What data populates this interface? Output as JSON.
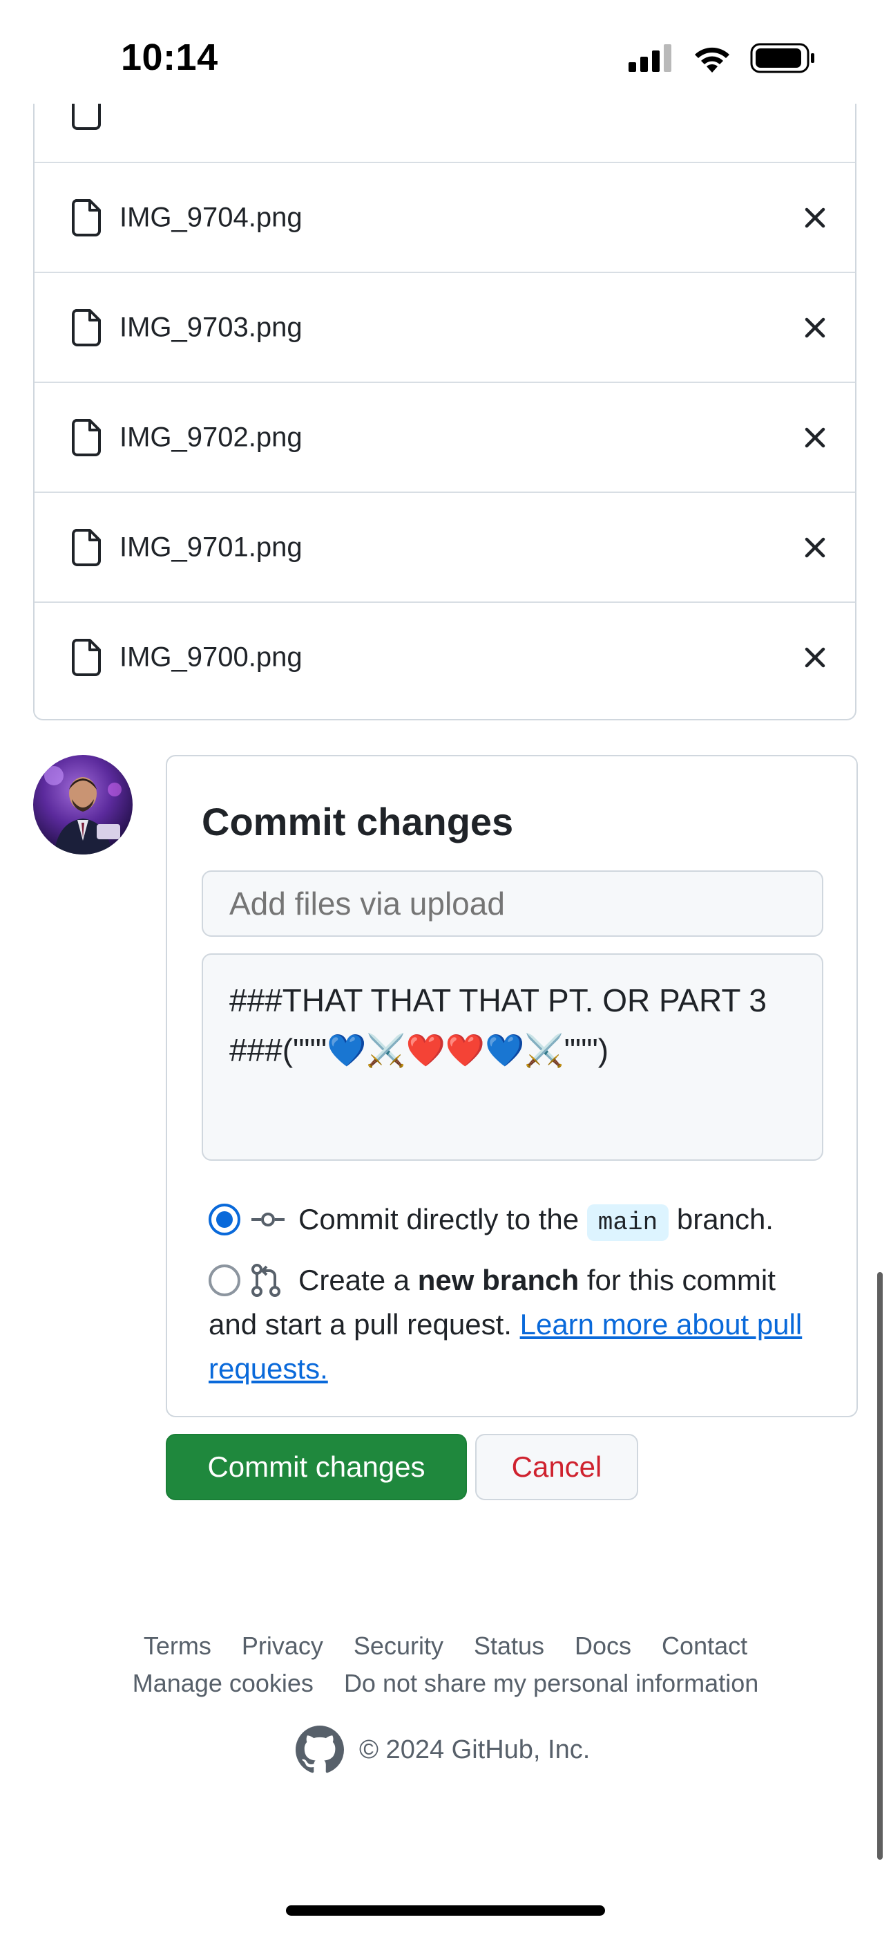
{
  "status_bar": {
    "time": "10:14"
  },
  "files": [
    {
      "name": "IMG_9704.png"
    },
    {
      "name": "IMG_9703.png"
    },
    {
      "name": "IMG_9702.png"
    },
    {
      "name": "IMG_9701.png"
    },
    {
      "name": "IMG_9700.png"
    }
  ],
  "commit": {
    "title": "Commit changes",
    "summary_placeholder": "Add files via upload",
    "description": "###THAT THAT THAT PT. OR PART 3\n###(\"\"\"💙⚔️❤️❤️💙⚔️\"\"\")",
    "option_direct": {
      "before": "Commit directly to the ",
      "branch": "main",
      "after": " branch."
    },
    "option_new_branch": {
      "before": "Create a ",
      "bold": "new branch",
      "after": " for this commit and start a pull request. ",
      "link": "Learn more about pull requests."
    },
    "selected_option": "direct"
  },
  "buttons": {
    "commit": "Commit changes",
    "cancel": "Cancel"
  },
  "footer": {
    "links_row1": [
      "Terms",
      "Privacy",
      "Security",
      "Status",
      "Docs",
      "Contact"
    ],
    "links_row2": [
      "Manage cookies",
      "Do not share my personal information"
    ],
    "copyright": "© 2024 GitHub, Inc."
  },
  "colors": {
    "primary_green": "#1f883d",
    "link_blue": "#0969da",
    "danger_red": "#cf222e",
    "border": "#d0d7de"
  },
  "icons": {
    "file_row": "file-icon",
    "remove": "x-icon",
    "commit_direct": "git-commit-icon",
    "new_branch": "git-pull-request-icon",
    "footer_logo": "github-mark-icon"
  }
}
